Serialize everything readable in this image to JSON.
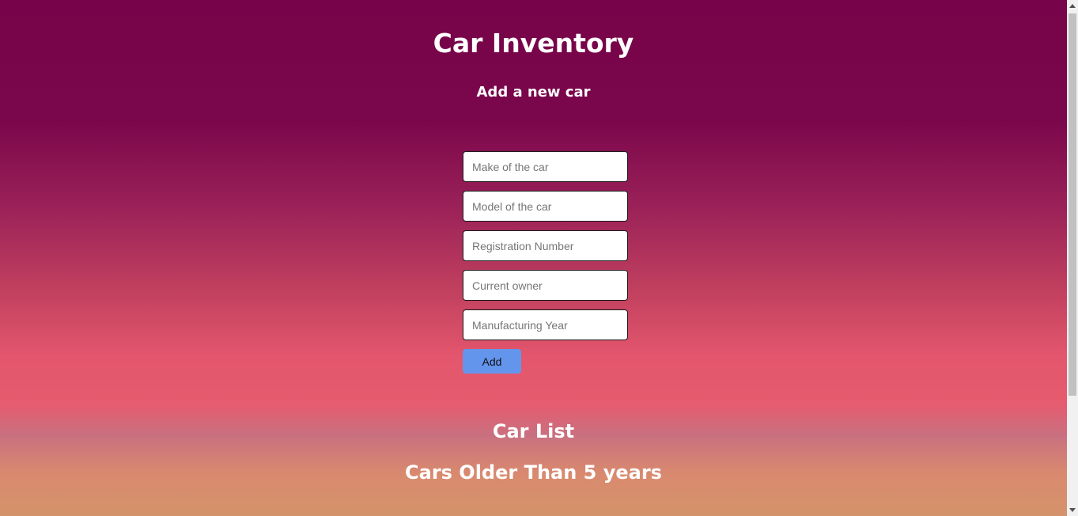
{
  "header": {
    "title": "Car Inventory",
    "subtitle": "Add a new car"
  },
  "form": {
    "make_placeholder": "Make of the car",
    "model_placeholder": "Model of the car",
    "registration_placeholder": "Registration Number",
    "owner_placeholder": "Current owner",
    "year_placeholder": "Manufacturing Year",
    "add_label": "Add"
  },
  "sections": {
    "car_list": "Car List",
    "older_cars": "Cars Older Than 5 years"
  },
  "colors": {
    "background_top": "#77044a",
    "background_middle": "#e65b6e",
    "background_bottom": "#d4936a",
    "add_button": "#6495ed"
  }
}
